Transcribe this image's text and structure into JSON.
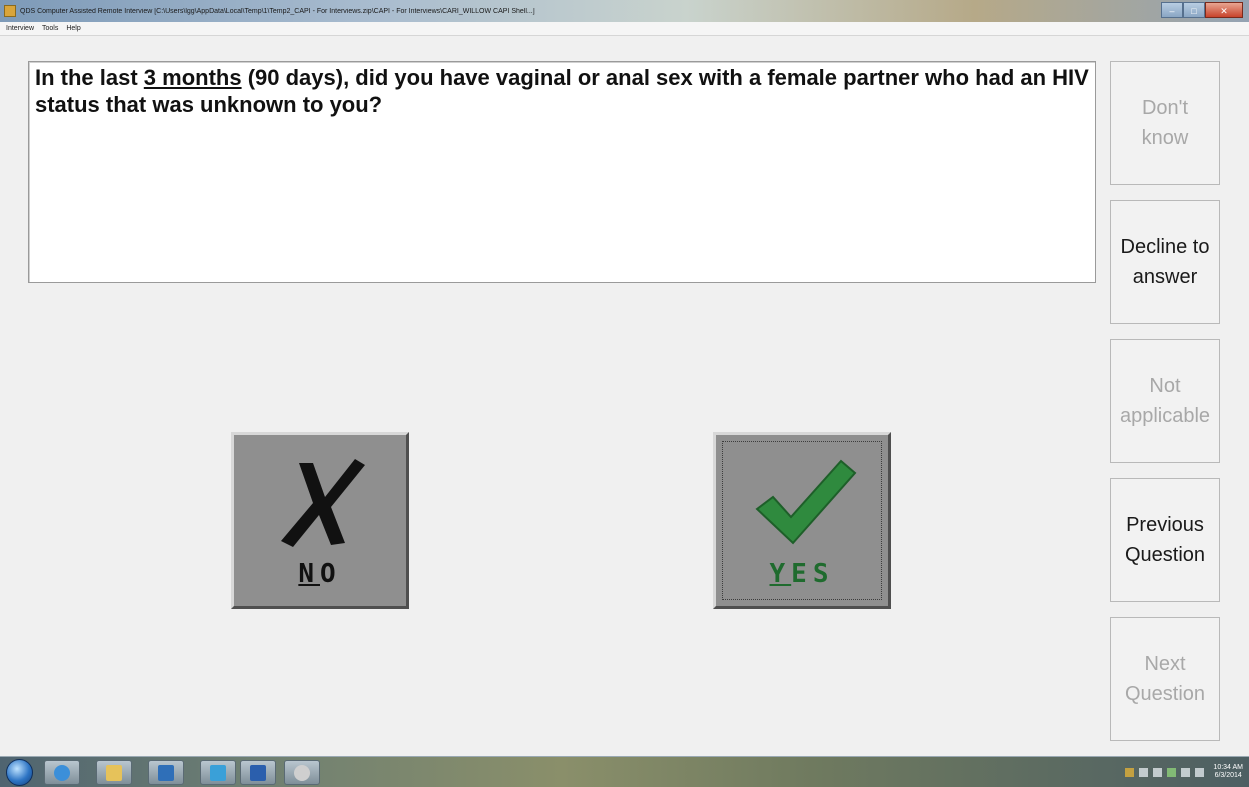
{
  "window": {
    "title": "QDS Computer Assisted Remote Interview [C:\\Users\\lgg\\AppData\\Local\\Temp\\1\\Temp2_CAPI - For Interviews.zip\\CAPI - For Interviews\\CARI_WILLOW CAPI Shell...]"
  },
  "menu": {
    "items": [
      "Interview",
      "Tools",
      "Help"
    ]
  },
  "question": {
    "prefix": "In the last ",
    "emphasis": "3 months",
    "rest": " (90 days), did you have vaginal or anal sex with a female partner who had an HIV status that was unknown to you?"
  },
  "side_buttons": {
    "dont_know": "Don't\nknow",
    "decline": "Decline to\nanswer",
    "not_applicable": "Not\napplicable",
    "previous": "Previous\nQuestion",
    "next": "Next\nQuestion"
  },
  "answers": {
    "no_hotkey": "N",
    "no_rest": "O",
    "yes_hotkey": "Y",
    "yes_rest": "ES"
  },
  "colors": {
    "check_green": "#2f8a3e",
    "disabled_text": "#a8a8a8"
  },
  "taskbar": {
    "icons": [
      "start-orb",
      "internet-explorer-icon",
      "file-explorer-icon",
      "outlook-icon",
      "lync-icon",
      "word-icon",
      "app-icon"
    ],
    "clock_time": "10:34 AM",
    "clock_date": "6/3/2014"
  }
}
